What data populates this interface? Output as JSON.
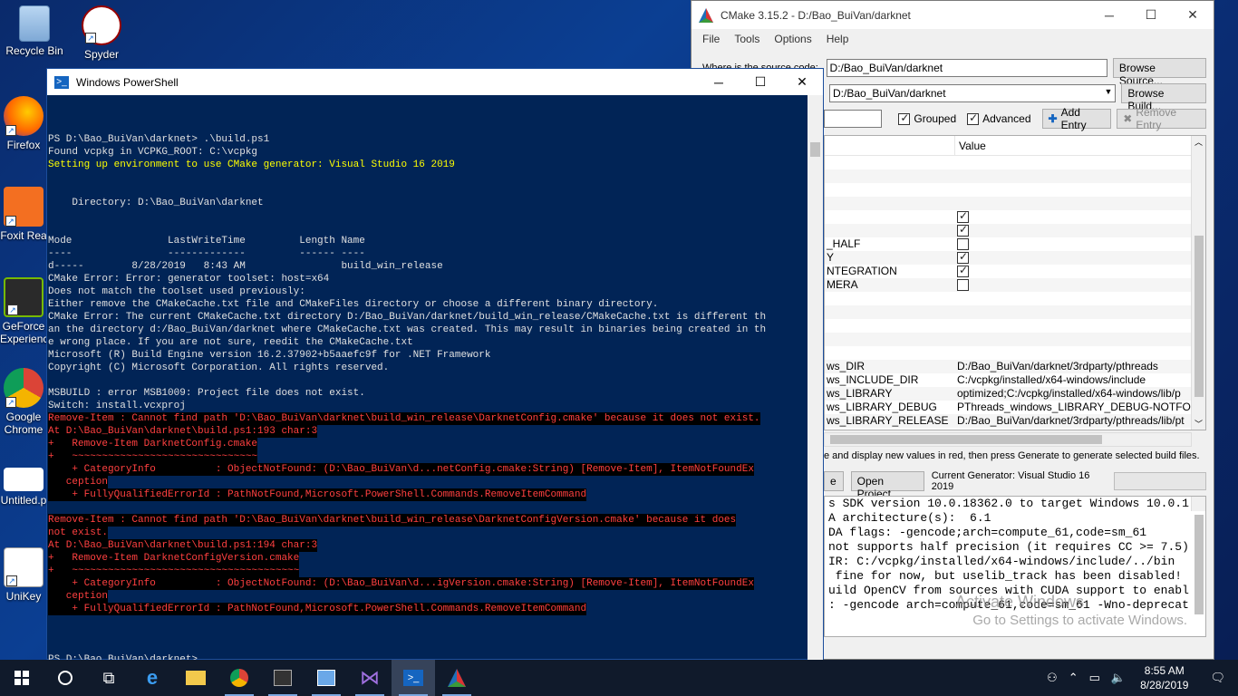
{
  "desktop": {
    "icons": [
      {
        "label": "Recycle Bin"
      },
      {
        "label": "Spyder"
      },
      {
        "label": "Firefox"
      },
      {
        "label": "Foxit Rea"
      },
      {
        "label": "GeForce Experience"
      },
      {
        "label": "Google Chrome"
      },
      {
        "label": "Untitled.p"
      },
      {
        "label": "UniKey"
      }
    ]
  },
  "cmake": {
    "title": "CMake 3.15.2 - D:/Bao_BuiVan/darknet",
    "menu": [
      "File",
      "Tools",
      "Options",
      "Help"
    ],
    "source_label": "Where is the source code:",
    "source_value": "D:/Bao_BuiVan/darknet",
    "browse_source": "Browse Source...",
    "build_value": "D:/Bao_BuiVan/darknet",
    "browse_build": "Browse Build...",
    "grouped_label": "Grouped",
    "grouped_checked": true,
    "advanced_label": "Advanced",
    "advanced_checked": true,
    "add_entry": "Add Entry",
    "remove_entry": "Remove Entry",
    "table_header_value": "Value",
    "rows": [
      {
        "name": "",
        "value": ""
      },
      {
        "name": "",
        "value": ""
      },
      {
        "name": "",
        "value": ""
      },
      {
        "name": "",
        "value": ""
      },
      {
        "name": "",
        "check": true
      },
      {
        "name": "",
        "check": true
      },
      {
        "name": "_HALF",
        "check": false
      },
      {
        "name": "Y",
        "check": true
      },
      {
        "name": "NTEGRATION",
        "check": true
      },
      {
        "name": "MERA",
        "check": false
      },
      {
        "name": "",
        "value": ""
      },
      {
        "name": "",
        "value": ""
      },
      {
        "name": "",
        "value": ""
      },
      {
        "name": "",
        "value": ""
      },
      {
        "name": "",
        "value": ""
      },
      {
        "name": "ws_DIR",
        "value": "D:/Bao_BuiVan/darknet/3rdparty/pthreads"
      },
      {
        "name": "ws_INCLUDE_DIR",
        "value": "C:/vcpkg/installed/x64-windows/include"
      },
      {
        "name": "ws_LIBRARY",
        "value": "optimized;C:/vcpkg/installed/x64-windows/lib/p"
      },
      {
        "name": "ws_LIBRARY_DEBUG",
        "value": "PThreads_windows_LIBRARY_DEBUG-NOTFOUNI"
      },
      {
        "name": "ws_LIBRARY_RELEASE",
        "value": "D:/Bao_BuiVan/darknet/3rdparty/pthreads/lib/pt"
      }
    ],
    "hint": "e and display new values in red, then press Generate to generate selected build files.",
    "generate_button": "e",
    "open_project": "Open Project",
    "current_generator": "Current Generator: Visual Studio 16 2019",
    "output_lines": [
      "s SDK version 10.0.18362.0 to target Windows 10.0.1",
      "A architecture(s):  6.1",
      "DA flags: -gencode;arch=compute_61,code=sm_61",
      "not supports half precision (it requires CC >= 7.5)",
      "IR: C:/vcpkg/installed/x64-windows/include/../bin",
      " fine for now, but uselib_track has been disabled!",
      "uild OpenCV from sources with CUDA support to enabl",
      ": -gencode arch=compute_61,code=sm_61 -Wno-deprecat"
    ]
  },
  "watermark": {
    "line1": "Activate Windows",
    "line2": "Go to Settings to activate Windows."
  },
  "powershell": {
    "title": "Windows PowerShell",
    "lines": [
      {
        "text": "",
        "style": "w"
      },
      {
        "text": "",
        "style": "w"
      },
      {
        "text": "",
        "style": "w"
      },
      {
        "text": "PS D:\\Bao_BuiVan\\darknet> .\\build.ps1",
        "style": "w",
        "cmd": ".\\build.ps1"
      },
      {
        "text": "Found vcpkg in VCPKG_ROOT: C:\\vcpkg",
        "style": "w"
      },
      {
        "text": "Setting up environment to use CMake generator: Visual Studio 16 2019",
        "style": "y"
      },
      {
        "text": "",
        "style": "w"
      },
      {
        "text": "",
        "style": "w"
      },
      {
        "text": "    Directory: D:\\Bao_BuiVan\\darknet",
        "style": "w"
      },
      {
        "text": "",
        "style": "w"
      },
      {
        "text": "",
        "style": "w"
      },
      {
        "text": "Mode                LastWriteTime         Length Name",
        "style": "w"
      },
      {
        "text": "----                -------------         ------ ----",
        "style": "w"
      },
      {
        "text": "d-----        8/28/2019   8:43 AM                build_win_release",
        "style": "w"
      },
      {
        "text": "CMake Error: Error: generator toolset: host=x64",
        "style": "w"
      },
      {
        "text": "Does not match the toolset used previously:",
        "style": "w"
      },
      {
        "text": "Either remove the CMakeCache.txt file and CMakeFiles directory or choose a different binary directory.",
        "style": "w"
      },
      {
        "text": "CMake Error: The current CMakeCache.txt directory D:/Bao_BuiVan/darknet/build_win_release/CMakeCache.txt is different th",
        "style": "w"
      },
      {
        "text": "an the directory d:/Bao_BuiVan/darknet where CMakeCache.txt was created. This may result in binaries being created in th",
        "style": "w"
      },
      {
        "text": "e wrong place. If you are not sure, reedit the CMakeCache.txt",
        "style": "w"
      },
      {
        "text": "Microsoft (R) Build Engine version 16.2.37902+b5aaefc9f for .NET Framework",
        "style": "w"
      },
      {
        "text": "Copyright (C) Microsoft Corporation. All rights reserved.",
        "style": "w"
      },
      {
        "text": "",
        "style": "w"
      },
      {
        "text": "MSBUILD : error MSB1009: Project file does not exist.",
        "style": "w"
      },
      {
        "text": "Switch: install.vcxproj",
        "style": "w"
      },
      {
        "text": "Remove-Item : Cannot find path 'D:\\Bao_BuiVan\\darknet\\build_win_release\\DarknetConfig.cmake' because it does not exist.",
        "style": "r"
      },
      {
        "text": "At D:\\Bao_BuiVan\\darknet\\build.ps1:193 char:3",
        "style": "r"
      },
      {
        "text": "+   Remove-Item DarknetConfig.cmake",
        "style": "r"
      },
      {
        "text": "+   ~~~~~~~~~~~~~~~~~~~~~~~~~~~~~~~",
        "style": "r"
      },
      {
        "text": "    + CategoryInfo          : ObjectNotFound: (D:\\Bao_BuiVan\\d...netConfig.cmake:String) [Remove-Item], ItemNotFoundEx",
        "style": "r"
      },
      {
        "text": "   ception",
        "style": "r"
      },
      {
        "text": "    + FullyQualifiedErrorId : PathNotFound,Microsoft.PowerShell.Commands.RemoveItemCommand",
        "style": "r"
      },
      {
        "text": "",
        "style": "r"
      },
      {
        "text": "Remove-Item : Cannot find path 'D:\\Bao_BuiVan\\darknet\\build_win_release\\DarknetConfigVersion.cmake' because it does",
        "style": "r"
      },
      {
        "text": "not exist.",
        "style": "r"
      },
      {
        "text": "At D:\\Bao_BuiVan\\darknet\\build.ps1:194 char:3",
        "style": "r"
      },
      {
        "text": "+   Remove-Item DarknetConfigVersion.cmake",
        "style": "r"
      },
      {
        "text": "+   ~~~~~~~~~~~~~~~~~~~~~~~~~~~~~~~~~~~~~~",
        "style": "r"
      },
      {
        "text": "    + CategoryInfo          : ObjectNotFound: (D:\\Bao_BuiVan\\d...igVersion.cmake:String) [Remove-Item], ItemNotFoundEx",
        "style": "r"
      },
      {
        "text": "   ception",
        "style": "r"
      },
      {
        "text": "    + FullyQualifiedErrorId : PathNotFound,Microsoft.PowerShell.Commands.RemoveItemCommand",
        "style": "r"
      },
      {
        "text": "",
        "style": "r"
      },
      {
        "text": "",
        "style": "w"
      },
      {
        "text": "",
        "style": "w"
      },
      {
        "text": "PS D:\\Bao_BuiVan\\darknet>",
        "style": "w"
      }
    ]
  },
  "taskbar": {
    "time": "8:55 AM",
    "date": "8/28/2019"
  },
  "colors": {
    "ps_bg": "#012456",
    "error_red": "#ff4040",
    "warn_yellow": "#ffff00"
  }
}
